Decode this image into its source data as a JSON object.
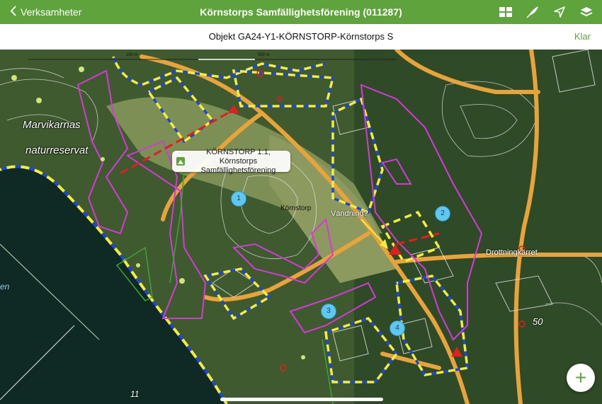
{
  "navbar": {
    "back_label": "Verksamheter",
    "title": "Körnstorps Samfällighetsförening (011287)",
    "icons": [
      "view-grid-icon",
      "draw-feather-icon",
      "location-arrow-icon",
      "layers-icon"
    ]
  },
  "subbar": {
    "title": "Objekt GA24-Y1-KÖRNSTORP-Körnstorps S",
    "done_label": "Klar"
  },
  "map": {
    "callout": {
      "line1": "KÖRNSTORP 1:1, Körnstorps",
      "line2": "Samfällighetsförening"
    },
    "labels": {
      "reserve_line1": "Marvikarnas",
      "reserve_line2": "naturreservat",
      "kornstorp": "Körnstorp",
      "vandning": "Vändning?",
      "drottningkarret": "Drottningkärret",
      "road_50": "50",
      "road_11": "11",
      "left_edge": "en"
    },
    "scale": {
      "a": "250 m",
      "b": "500 m"
    },
    "pins": [
      "1",
      "2",
      "3",
      "4"
    ],
    "colors": {
      "road_line": "#e8a33a",
      "blue_dash": "#1f47d6",
      "yellow_dash": "#f4ee3a",
      "magenta": "#d43ad8",
      "red_dash": "#e02020",
      "pin_fill": "#5ec8f0",
      "accent": "#5ea33b"
    }
  },
  "fab": {
    "label": "+"
  }
}
